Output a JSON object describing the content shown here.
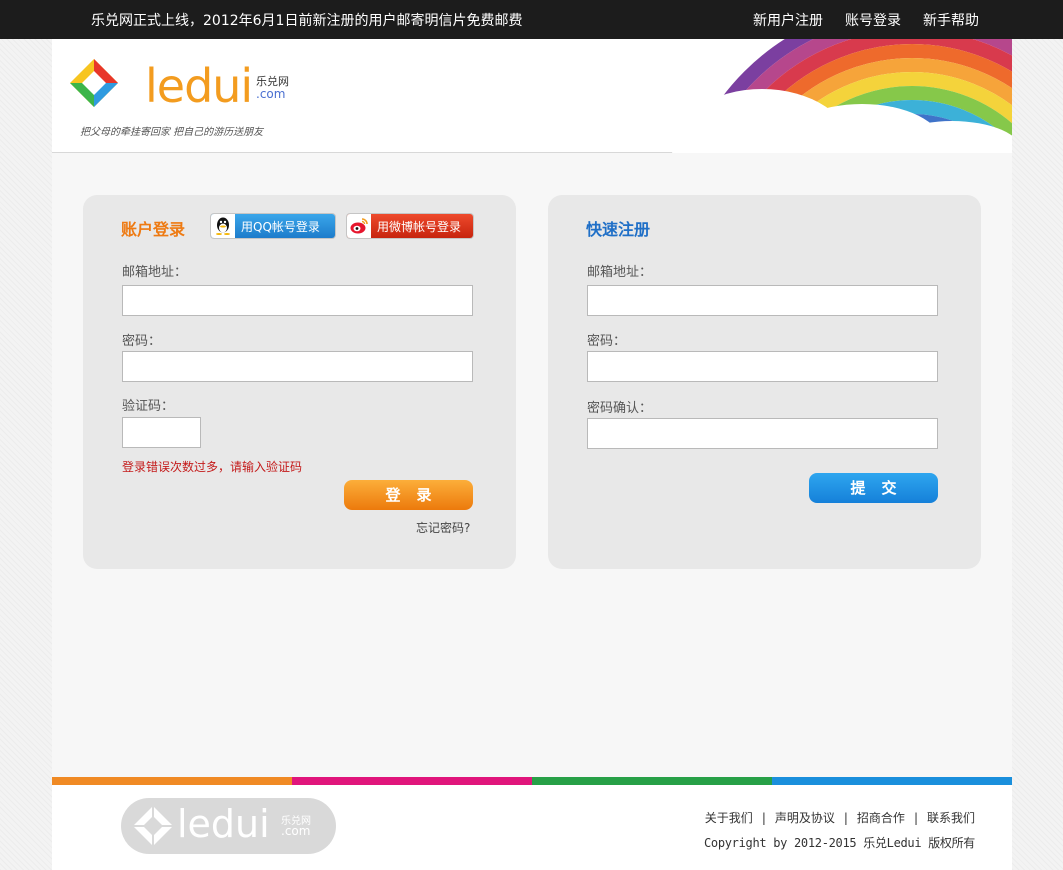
{
  "topbar": {
    "notice": "乐兑网正式上线，2012年6月1日前新注册的用户邮寄明信片免费邮费",
    "nav": [
      "新用户注册",
      "账号登录",
      "新手帮助"
    ]
  },
  "header": {
    "logo_text": "ledui",
    "logo_cn": "乐兑网",
    "logo_com": ".com",
    "slogan": "把父母的牵挂寄回家  把自己的游历送朋友"
  },
  "login": {
    "title": "账户登录",
    "qq_label": "用QQ帐号登录",
    "weibo_label": "用微博帐号登录",
    "email_label": "邮箱地址：",
    "email_value": "",
    "password_label": "密码：",
    "password_value": "",
    "captcha_label": "验证码：",
    "captcha_value": "",
    "error": "登录错误次数过多，请输入验证码",
    "button": "登录",
    "forgot": "忘记密码?"
  },
  "register": {
    "title": "快速注册",
    "email_label": "邮箱地址：",
    "email_value": "",
    "password_label": "密码：",
    "password_value": "",
    "confirm_label": "密码确认：",
    "confirm_value": "",
    "button": "提交"
  },
  "footer": {
    "logo_text": "ledui",
    "logo_cn": "乐兑网",
    "logo_com": ".com",
    "links": [
      "关于我们",
      "声明及协议",
      "招商合作",
      "联系我们"
    ],
    "copyright": "Copyright by 2012-2015 乐兑Ledui 版权所有"
  },
  "colors": {
    "orange": "#ee7a12",
    "blue": "#1f6fc7",
    "error_red": "#c41a1a",
    "stripe": [
      "#f08a24",
      "#e0157b",
      "#27a047",
      "#1a8fdc"
    ]
  }
}
